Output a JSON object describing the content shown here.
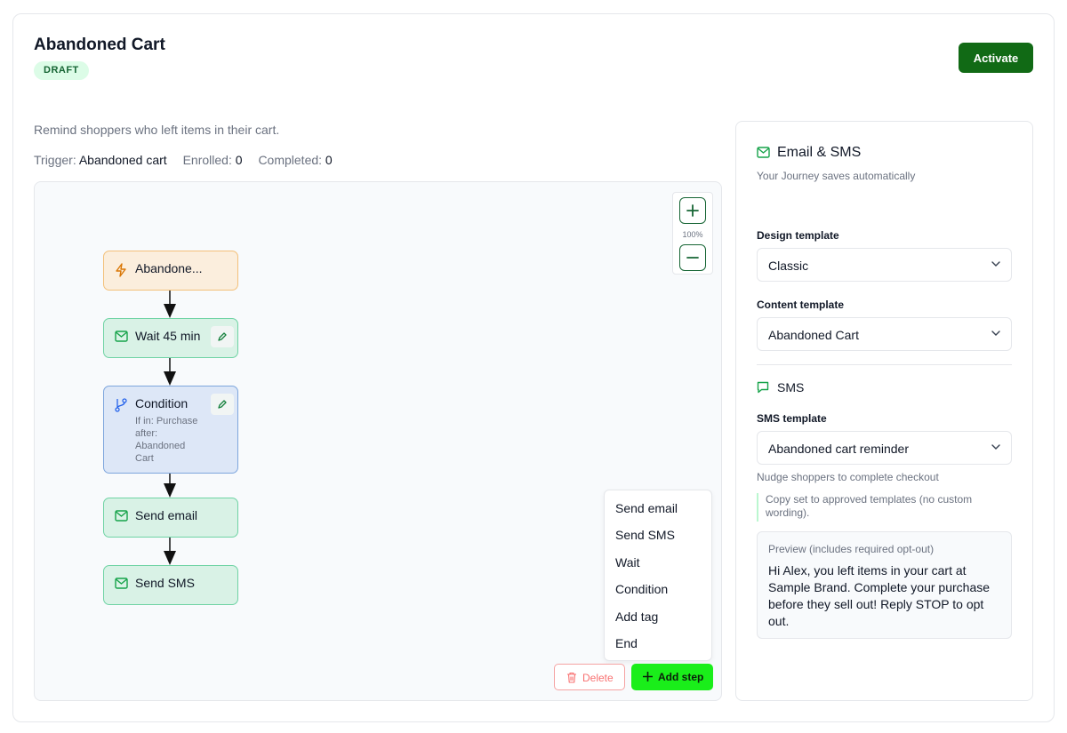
{
  "header": {
    "title": "Abandoned Cart",
    "status": "DRAFT",
    "activate_label": "Activate"
  },
  "summary": {
    "description": "Remind shoppers who left items in their cart.",
    "trigger_label": "Trigger:",
    "trigger_value": "Abandoned cart",
    "enrolled_label": "Enrolled:",
    "enrolled_value": "0",
    "completed_label": "Completed:",
    "completed_value": "0"
  },
  "canvas": {
    "zoom_level": "100%",
    "nodes": [
      {
        "label": "Abandone...",
        "kind": "trigger",
        "icon": "lightning-icon"
      },
      {
        "label": "Wait 45 min",
        "kind": "action",
        "icon": "mail-icon"
      },
      {
        "label": "Condition",
        "kind": "condition",
        "icon": "branch-icon",
        "detail": "If in: Purchase after: Abandoned Cart"
      },
      {
        "label": "Send email",
        "kind": "action",
        "icon": "mail-icon"
      },
      {
        "label": "Send SMS",
        "kind": "action",
        "icon": "mail-icon"
      }
    ],
    "step_menu": [
      "Send email",
      "Send SMS",
      "Wait",
      "Condition",
      "Add tag",
      "End"
    ],
    "delete_label": "Delete",
    "add_step_label": "Add step"
  },
  "panel": {
    "title": "Email & SMS",
    "autosave_note": "Your Journey saves automatically",
    "design_template_label": "Design template",
    "design_template_value": "Classic",
    "content_template_label": "Content template",
    "content_template_value": "Abandoned Cart",
    "sms_title": "SMS",
    "sms_template_label": "SMS template",
    "sms_template_value": "Abandoned cart reminder",
    "sms_template_hint": "Nudge shoppers to complete checkout",
    "copy_note": "Copy set to approved templates (no custom wording).",
    "preview_label": "Preview (includes required opt-out)",
    "preview_text": "Hi Alex, you left items in your cart at Sample Brand. Complete your purchase before they sell out! Reply STOP to opt out."
  },
  "colors": {
    "primary": "#116a15",
    "add_step": "#1aee1a",
    "trigger_fill": "#fbeedd",
    "action_fill": "#d9f2e6",
    "condition_fill": "#dde7f7",
    "delete": "#f87171"
  }
}
